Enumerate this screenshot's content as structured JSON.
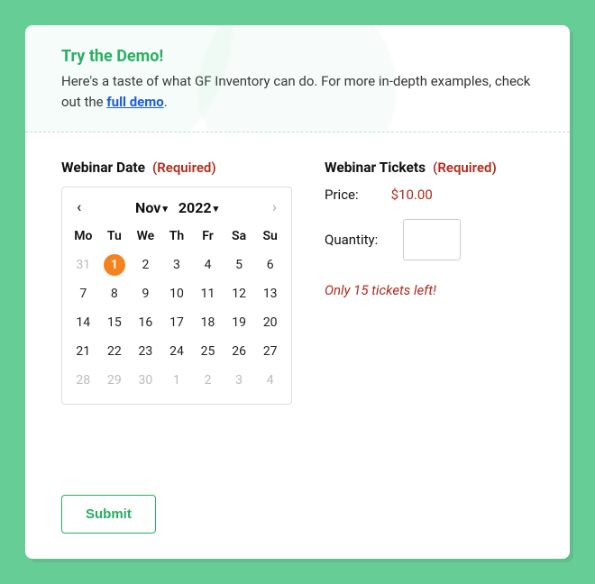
{
  "intro": {
    "title": "Try the Demo!",
    "text_before": "Here's a taste of what GF Inventory can do. For more in-depth examples, check out the ",
    "link_text": "full demo",
    "text_after": "."
  },
  "form": {
    "date_label": "Webinar Date",
    "tickets_label": "Webinar Tickets",
    "required": "(Required)",
    "price_label": "Price:",
    "price_value": "$10.00",
    "quantity_label": "Quantity:",
    "quantity_value": "",
    "stock_msg": "Only 15 tickets left!",
    "submit": "Submit"
  },
  "calendar": {
    "prev": "‹",
    "next": "›",
    "month": "Nov",
    "year": "2022",
    "weekdays": [
      "Mo",
      "Tu",
      "We",
      "Th",
      "Fr",
      "Sa",
      "Su"
    ],
    "weeks": [
      [
        {
          "d": "31",
          "muted": true
        },
        {
          "d": "1",
          "selected": true
        },
        {
          "d": "2"
        },
        {
          "d": "3"
        },
        {
          "d": "4"
        },
        {
          "d": "5"
        },
        {
          "d": "6"
        }
      ],
      [
        {
          "d": "7"
        },
        {
          "d": "8"
        },
        {
          "d": "9"
        },
        {
          "d": "10"
        },
        {
          "d": "11"
        },
        {
          "d": "12"
        },
        {
          "d": "13"
        }
      ],
      [
        {
          "d": "14"
        },
        {
          "d": "15"
        },
        {
          "d": "16"
        },
        {
          "d": "17"
        },
        {
          "d": "18"
        },
        {
          "d": "19"
        },
        {
          "d": "20"
        }
      ],
      [
        {
          "d": "21"
        },
        {
          "d": "22"
        },
        {
          "d": "23"
        },
        {
          "d": "24"
        },
        {
          "d": "25"
        },
        {
          "d": "26"
        },
        {
          "d": "27"
        }
      ],
      [
        {
          "d": "28",
          "muted": true
        },
        {
          "d": "29",
          "muted": true
        },
        {
          "d": "30",
          "muted": true
        },
        {
          "d": "1",
          "muted": true
        },
        {
          "d": "2",
          "muted": true
        },
        {
          "d": "3",
          "muted": true
        },
        {
          "d": "4",
          "muted": true
        }
      ]
    ]
  }
}
